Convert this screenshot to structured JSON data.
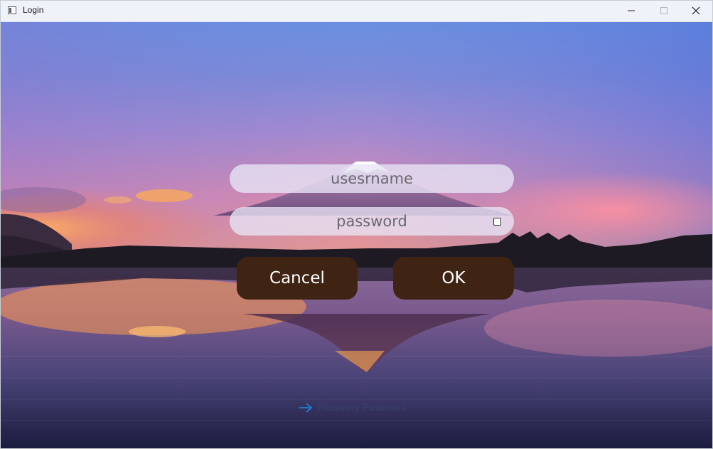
{
  "window": {
    "title": "Login"
  },
  "login": {
    "username_placeholder": "usesrname",
    "password_placeholder": "password",
    "cancel_label": "Cancel",
    "ok_label": "OK",
    "recovery_label": "Recovery Password"
  },
  "icons": {
    "app": "window-icon",
    "minimize": "minimize-icon",
    "maximize": "maximize-icon",
    "close": "close-icon",
    "recovery": "arrow-right-icon"
  },
  "colors": {
    "button_bg": "#3f2313",
    "field_bg": "#e8e6f6",
    "recovery_arrow": "#1e7fd6"
  }
}
